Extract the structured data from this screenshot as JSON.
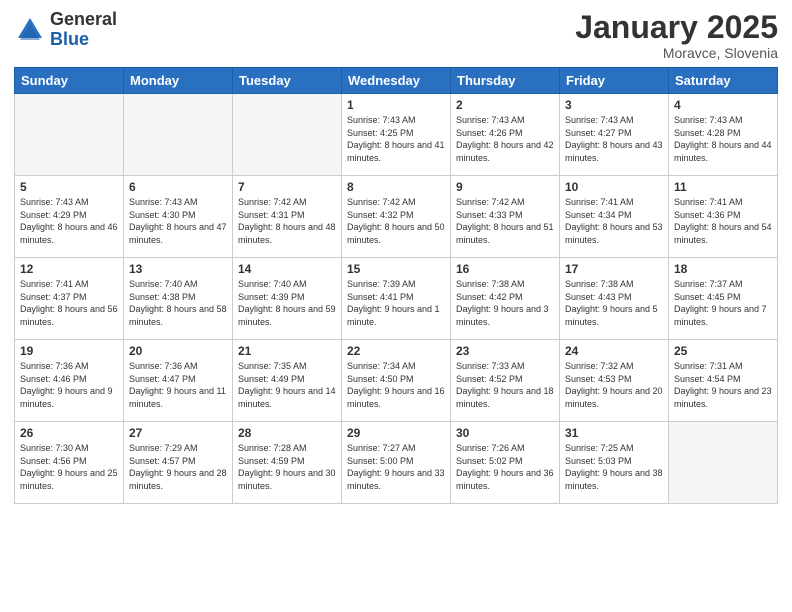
{
  "logo": {
    "general": "General",
    "blue": "Blue"
  },
  "title": "January 2025",
  "location": "Moravce, Slovenia",
  "days_header": [
    "Sunday",
    "Monday",
    "Tuesday",
    "Wednesday",
    "Thursday",
    "Friday",
    "Saturday"
  ],
  "weeks": [
    [
      {
        "day": "",
        "info": ""
      },
      {
        "day": "",
        "info": ""
      },
      {
        "day": "",
        "info": ""
      },
      {
        "day": "1",
        "info": "Sunrise: 7:43 AM\nSunset: 4:25 PM\nDaylight: 8 hours\nand 41 minutes."
      },
      {
        "day": "2",
        "info": "Sunrise: 7:43 AM\nSunset: 4:26 PM\nDaylight: 8 hours\nand 42 minutes."
      },
      {
        "day": "3",
        "info": "Sunrise: 7:43 AM\nSunset: 4:27 PM\nDaylight: 8 hours\nand 43 minutes."
      },
      {
        "day": "4",
        "info": "Sunrise: 7:43 AM\nSunset: 4:28 PM\nDaylight: 8 hours\nand 44 minutes."
      }
    ],
    [
      {
        "day": "5",
        "info": "Sunrise: 7:43 AM\nSunset: 4:29 PM\nDaylight: 8 hours\nand 46 minutes."
      },
      {
        "day": "6",
        "info": "Sunrise: 7:43 AM\nSunset: 4:30 PM\nDaylight: 8 hours\nand 47 minutes."
      },
      {
        "day": "7",
        "info": "Sunrise: 7:42 AM\nSunset: 4:31 PM\nDaylight: 8 hours\nand 48 minutes."
      },
      {
        "day": "8",
        "info": "Sunrise: 7:42 AM\nSunset: 4:32 PM\nDaylight: 8 hours\nand 50 minutes."
      },
      {
        "day": "9",
        "info": "Sunrise: 7:42 AM\nSunset: 4:33 PM\nDaylight: 8 hours\nand 51 minutes."
      },
      {
        "day": "10",
        "info": "Sunrise: 7:41 AM\nSunset: 4:34 PM\nDaylight: 8 hours\nand 53 minutes."
      },
      {
        "day": "11",
        "info": "Sunrise: 7:41 AM\nSunset: 4:36 PM\nDaylight: 8 hours\nand 54 minutes."
      }
    ],
    [
      {
        "day": "12",
        "info": "Sunrise: 7:41 AM\nSunset: 4:37 PM\nDaylight: 8 hours\nand 56 minutes."
      },
      {
        "day": "13",
        "info": "Sunrise: 7:40 AM\nSunset: 4:38 PM\nDaylight: 8 hours\nand 58 minutes."
      },
      {
        "day": "14",
        "info": "Sunrise: 7:40 AM\nSunset: 4:39 PM\nDaylight: 8 hours\nand 59 minutes."
      },
      {
        "day": "15",
        "info": "Sunrise: 7:39 AM\nSunset: 4:41 PM\nDaylight: 9 hours\nand 1 minute."
      },
      {
        "day": "16",
        "info": "Sunrise: 7:38 AM\nSunset: 4:42 PM\nDaylight: 9 hours\nand 3 minutes."
      },
      {
        "day": "17",
        "info": "Sunrise: 7:38 AM\nSunset: 4:43 PM\nDaylight: 9 hours\nand 5 minutes."
      },
      {
        "day": "18",
        "info": "Sunrise: 7:37 AM\nSunset: 4:45 PM\nDaylight: 9 hours\nand 7 minutes."
      }
    ],
    [
      {
        "day": "19",
        "info": "Sunrise: 7:36 AM\nSunset: 4:46 PM\nDaylight: 9 hours\nand 9 minutes."
      },
      {
        "day": "20",
        "info": "Sunrise: 7:36 AM\nSunset: 4:47 PM\nDaylight: 9 hours\nand 11 minutes."
      },
      {
        "day": "21",
        "info": "Sunrise: 7:35 AM\nSunset: 4:49 PM\nDaylight: 9 hours\nand 14 minutes."
      },
      {
        "day": "22",
        "info": "Sunrise: 7:34 AM\nSunset: 4:50 PM\nDaylight: 9 hours\nand 16 minutes."
      },
      {
        "day": "23",
        "info": "Sunrise: 7:33 AM\nSunset: 4:52 PM\nDaylight: 9 hours\nand 18 minutes."
      },
      {
        "day": "24",
        "info": "Sunrise: 7:32 AM\nSunset: 4:53 PM\nDaylight: 9 hours\nand 20 minutes."
      },
      {
        "day": "25",
        "info": "Sunrise: 7:31 AM\nSunset: 4:54 PM\nDaylight: 9 hours\nand 23 minutes."
      }
    ],
    [
      {
        "day": "26",
        "info": "Sunrise: 7:30 AM\nSunset: 4:56 PM\nDaylight: 9 hours\nand 25 minutes."
      },
      {
        "day": "27",
        "info": "Sunrise: 7:29 AM\nSunset: 4:57 PM\nDaylight: 9 hours\nand 28 minutes."
      },
      {
        "day": "28",
        "info": "Sunrise: 7:28 AM\nSunset: 4:59 PM\nDaylight: 9 hours\nand 30 minutes."
      },
      {
        "day": "29",
        "info": "Sunrise: 7:27 AM\nSunset: 5:00 PM\nDaylight: 9 hours\nand 33 minutes."
      },
      {
        "day": "30",
        "info": "Sunrise: 7:26 AM\nSunset: 5:02 PM\nDaylight: 9 hours\nand 36 minutes."
      },
      {
        "day": "31",
        "info": "Sunrise: 7:25 AM\nSunset: 5:03 PM\nDaylight: 9 hours\nand 38 minutes."
      },
      {
        "day": "",
        "info": ""
      }
    ]
  ]
}
